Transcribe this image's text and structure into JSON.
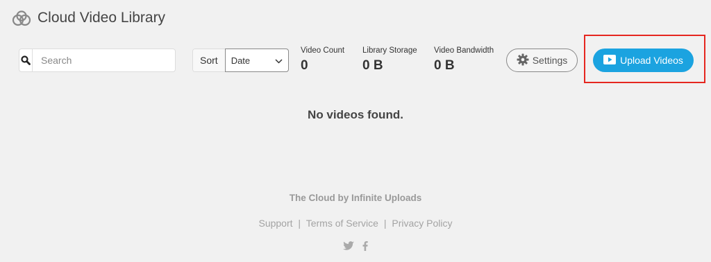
{
  "header": {
    "logo_icon": "cloud-rings-icon",
    "title": "Cloud Video Library"
  },
  "toolbar": {
    "search": {
      "icon": "search-icon",
      "placeholder": "Search",
      "value": ""
    },
    "sort": {
      "label": "Sort",
      "selected": "Date",
      "icon": "chevron-down-icon"
    },
    "stats": [
      {
        "label": "Video Count",
        "value": "0"
      },
      {
        "label": "Library Storage",
        "value": "0 B"
      },
      {
        "label": "Video Bandwidth",
        "value": "0 B"
      }
    ],
    "settings_label": "Settings",
    "settings_icon": "gear-icon",
    "upload_label": "Upload Videos",
    "upload_icon": "play-icon"
  },
  "main": {
    "empty_message": "No videos found."
  },
  "footer": {
    "brand": "The Cloud by Infinite Uploads",
    "links": [
      "Support",
      "Terms of Service",
      "Privacy Policy"
    ],
    "separator": "|",
    "social_icons": [
      "twitter-icon",
      "facebook-icon"
    ]
  },
  "colors": {
    "background": "#f1f1f1",
    "accent": "#1ba3e0",
    "highlight_border": "#e5261f"
  }
}
